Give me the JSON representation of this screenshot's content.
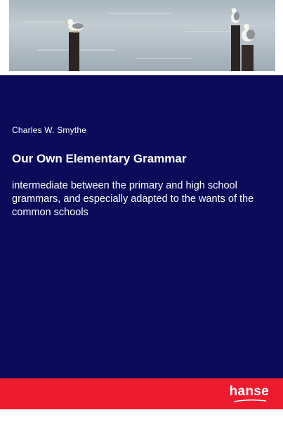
{
  "cover": {
    "author": "Charles W. Smythe",
    "title": "Our Own Elementary Grammar",
    "subtitle": "intermediate between the primary and high school grammars, and especially adapted to the wants of the common schools",
    "publisher": "hanse"
  },
  "photo": {
    "description_icon": "seagulls-on-posts-photo"
  },
  "colors": {
    "panel": "#0b0b59",
    "publisher_bar": "#ee1b2e",
    "text": "#ffffff"
  }
}
